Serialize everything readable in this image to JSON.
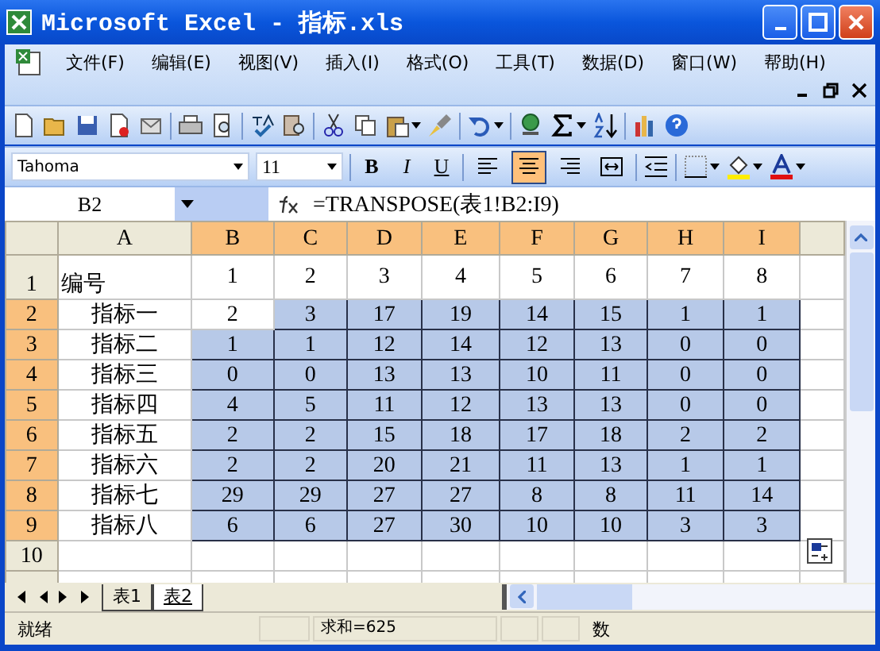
{
  "window": {
    "title": "Microsoft Excel - 指标.xls"
  },
  "menu": [
    {
      "label": "文件(F)"
    },
    {
      "label": "编辑(E)"
    },
    {
      "label": "视图(V)"
    },
    {
      "label": "插入(I)"
    },
    {
      "label": "格式(O)"
    },
    {
      "label": "工具(T)"
    },
    {
      "label": "数据(D)"
    },
    {
      "label": "窗口(W)"
    },
    {
      "label": "帮助(H)"
    }
  ],
  "format_toolbar": {
    "font": "Tahoma",
    "size": "11",
    "bold": "B",
    "italic": "I",
    "underline": "U",
    "alignment": [
      {
        "kind": "left",
        "selected": false
      },
      {
        "kind": "center",
        "selected": true
      },
      {
        "kind": "right",
        "selected": false
      },
      {
        "kind": "merge",
        "selected": false
      }
    ]
  },
  "formula_bar": {
    "name_box": "B2",
    "formula": "=TRANSPOSE(表1!B2:I9)"
  },
  "columns": [
    {
      "label": "A",
      "selected": false
    },
    {
      "label": "B",
      "selected": true
    },
    {
      "label": "C",
      "selected": true
    },
    {
      "label": "D",
      "selected": true
    },
    {
      "label": "E",
      "selected": true
    },
    {
      "label": "F",
      "selected": true
    },
    {
      "label": "G",
      "selected": true
    },
    {
      "label": "H",
      "selected": true
    },
    {
      "label": "I",
      "selected": true
    }
  ],
  "rows": [
    {
      "label": "1",
      "selected": false,
      "cells": [
        {
          "text": "编号",
          "selected": false
        },
        {
          "text": "1",
          "selected": false
        },
        {
          "text": "2",
          "selected": false
        },
        {
          "text": "3",
          "selected": false
        },
        {
          "text": "4",
          "selected": false
        },
        {
          "text": "5",
          "selected": false
        },
        {
          "text": "6",
          "selected": false
        },
        {
          "text": "7",
          "selected": false
        },
        {
          "text": "8",
          "selected": false
        }
      ]
    },
    {
      "label": "2",
      "selected": true,
      "cells": [
        {
          "text": "指标一",
          "selected": false
        },
        {
          "text": "2",
          "selected": false
        },
        {
          "text": "3",
          "selected": true
        },
        {
          "text": "17",
          "selected": true
        },
        {
          "text": "19",
          "selected": true
        },
        {
          "text": "14",
          "selected": true
        },
        {
          "text": "15",
          "selected": true
        },
        {
          "text": "1",
          "selected": true
        },
        {
          "text": "1",
          "selected": true
        }
      ]
    },
    {
      "label": "3",
      "selected": true,
      "cells": [
        {
          "text": "指标二",
          "selected": false
        },
        {
          "text": "1",
          "selected": true
        },
        {
          "text": "1",
          "selected": true
        },
        {
          "text": "12",
          "selected": true
        },
        {
          "text": "14",
          "selected": true
        },
        {
          "text": "12",
          "selected": true
        },
        {
          "text": "13",
          "selected": true
        },
        {
          "text": "0",
          "selected": true
        },
        {
          "text": "0",
          "selected": true
        }
      ]
    },
    {
      "label": "4",
      "selected": true,
      "cells": [
        {
          "text": "指标三",
          "selected": false
        },
        {
          "text": "0",
          "selected": true
        },
        {
          "text": "0",
          "selected": true
        },
        {
          "text": "13",
          "selected": true
        },
        {
          "text": "13",
          "selected": true
        },
        {
          "text": "10",
          "selected": true
        },
        {
          "text": "11",
          "selected": true
        },
        {
          "text": "0",
          "selected": true
        },
        {
          "text": "0",
          "selected": true
        }
      ]
    },
    {
      "label": "5",
      "selected": true,
      "cells": [
        {
          "text": "指标四",
          "selected": false
        },
        {
          "text": "4",
          "selected": true
        },
        {
          "text": "5",
          "selected": true
        },
        {
          "text": "11",
          "selected": true
        },
        {
          "text": "12",
          "selected": true
        },
        {
          "text": "13",
          "selected": true
        },
        {
          "text": "13",
          "selected": true
        },
        {
          "text": "0",
          "selected": true
        },
        {
          "text": "0",
          "selected": true
        }
      ]
    },
    {
      "label": "6",
      "selected": true,
      "cells": [
        {
          "text": "指标五",
          "selected": false
        },
        {
          "text": "2",
          "selected": true
        },
        {
          "text": "2",
          "selected": true
        },
        {
          "text": "15",
          "selected": true
        },
        {
          "text": "18",
          "selected": true
        },
        {
          "text": "17",
          "selected": true
        },
        {
          "text": "18",
          "selected": true
        },
        {
          "text": "2",
          "selected": true
        },
        {
          "text": "2",
          "selected": true
        }
      ]
    },
    {
      "label": "7",
      "selected": true,
      "cells": [
        {
          "text": "指标六",
          "selected": false
        },
        {
          "text": "2",
          "selected": true
        },
        {
          "text": "2",
          "selected": true
        },
        {
          "text": "20",
          "selected": true
        },
        {
          "text": "21",
          "selected": true
        },
        {
          "text": "11",
          "selected": true
        },
        {
          "text": "13",
          "selected": true
        },
        {
          "text": "1",
          "selected": true
        },
        {
          "text": "1",
          "selected": true
        }
      ]
    },
    {
      "label": "8",
      "selected": true,
      "cells": [
        {
          "text": "指标七",
          "selected": false
        },
        {
          "text": "29",
          "selected": true
        },
        {
          "text": "29",
          "selected": true
        },
        {
          "text": "27",
          "selected": true
        },
        {
          "text": "27",
          "selected": true
        },
        {
          "text": "8",
          "selected": true
        },
        {
          "text": "8",
          "selected": true
        },
        {
          "text": "11",
          "selected": true
        },
        {
          "text": "14",
          "selected": true
        }
      ]
    },
    {
      "label": "9",
      "selected": true,
      "cells": [
        {
          "text": "指标八",
          "selected": false
        },
        {
          "text": "6",
          "selected": true
        },
        {
          "text": "6",
          "selected": true
        },
        {
          "text": "27",
          "selected": true
        },
        {
          "text": "30",
          "selected": true
        },
        {
          "text": "10",
          "selected": true
        },
        {
          "text": "10",
          "selected": true
        },
        {
          "text": "3",
          "selected": true
        },
        {
          "text": "3",
          "selected": true
        }
      ]
    },
    {
      "label": "10",
      "selected": false,
      "cells": []
    }
  ],
  "sheet_tabs": [
    {
      "label": "表1",
      "selected": false
    },
    {
      "label": "表2",
      "selected": true
    }
  ],
  "status_bar": {
    "state": "就绪",
    "sum": "求和=625",
    "indicator": "数"
  }
}
